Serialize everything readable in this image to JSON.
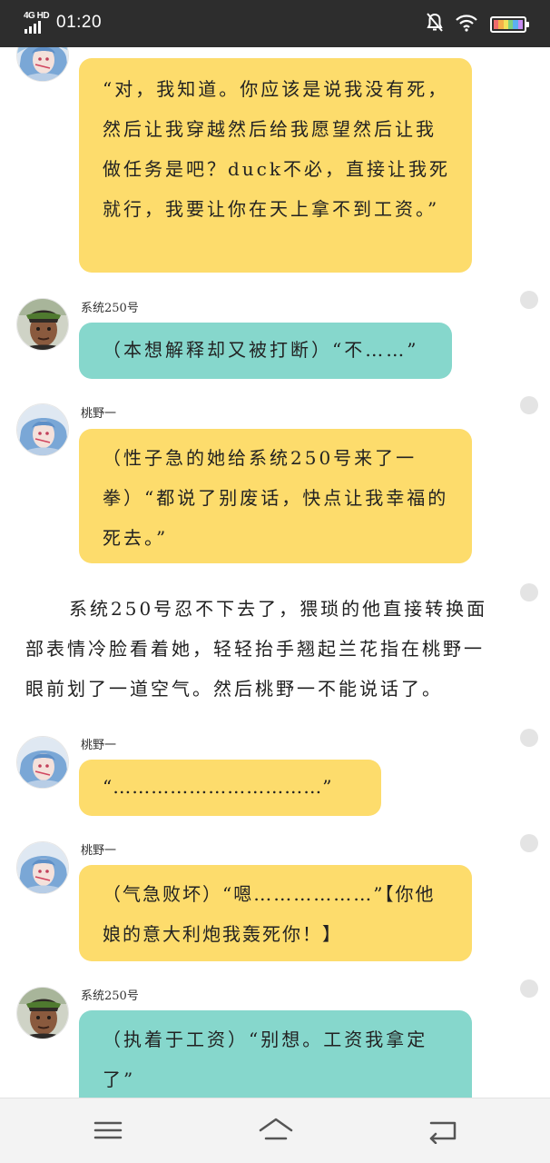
{
  "status_bar": {
    "network": "4G HD",
    "time": "01:20",
    "icons": [
      "signal-icon",
      "mute-bell-icon",
      "wifi-icon",
      "battery-icon"
    ]
  },
  "colors": {
    "yellow_bubble": "#fddc6c",
    "teal_bubble": "#86d7cc",
    "status_bar": "#2d2d2d"
  },
  "messages": [
    {
      "speaker": "",
      "name": "",
      "text": "“对，我知道。你应该是说我没有死，然后让我穿越然后给我愿望然后让我做任务是吧？duck不必，直接让我死就行，我要让你在天上拿不到工资。”"
    },
    {
      "speaker": "system",
      "name": "系统250号",
      "text": "（本想解释却又被打断）“不……”"
    },
    {
      "speaker": "taoye",
      "name": "桃野一",
      "text": "（性子急的她给系统250号来了一拳）“都说了别废话，快点让我幸福的死去。”"
    },
    {
      "speaker": "narration",
      "name": "",
      "text": "系统250号忍不下去了，猥琐的他直接转换面部表情冷脸看着她，轻轻抬手翘起兰花指在桃野一眼前划了一道空气。然后桃野一不能说话了。"
    },
    {
      "speaker": "taoye",
      "name": "桃野一",
      "text": "“……………………………”"
    },
    {
      "speaker": "taoye",
      "name": "桃野一",
      "text": "（气急败坏）“嗯………………”【你他娘的意大利炮我轰死你！】"
    },
    {
      "speaker": "system",
      "name": "系统250号",
      "text": "（执着于工资）“别想。工资我拿定了”"
    }
  ],
  "nav": {
    "items": [
      "menu-icon",
      "home-icon",
      "back-icon"
    ]
  }
}
